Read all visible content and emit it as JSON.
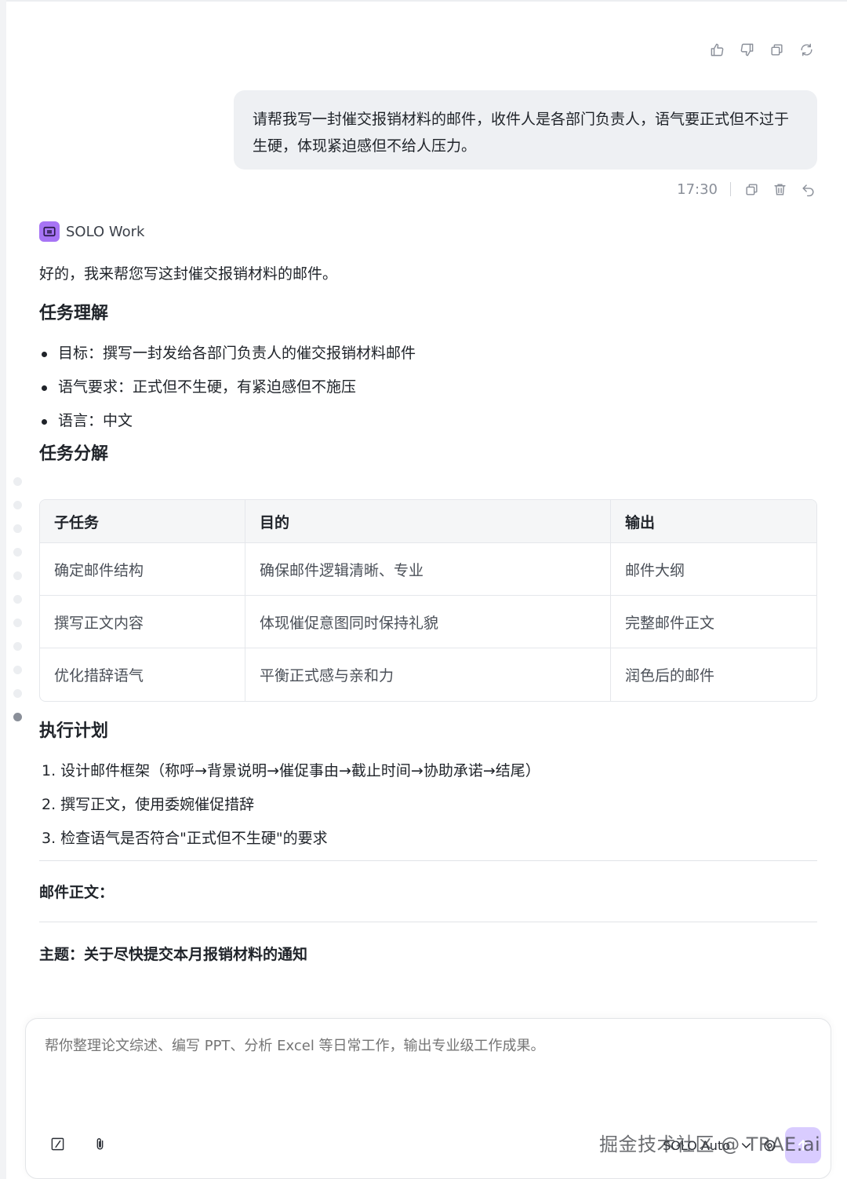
{
  "message_actions": {
    "icons": [
      "thumbs-up-icon",
      "thumbs-down-icon",
      "copy-icon",
      "refresh-icon"
    ]
  },
  "user_message": {
    "text": "请帮我写一封催交报销材料的邮件，收件人是各部门负责人，语气要正式但不过于生硬，体现紧迫感但不给人压力。",
    "time": "17:30",
    "icons": [
      "copy-icon",
      "delete-icon",
      "undo-icon"
    ]
  },
  "agent": {
    "name": "SOLO Work",
    "intro": "好的，我来帮您写这封催交报销材料的邮件。",
    "section1_title": "任务理解",
    "bullets": [
      "目标：撰写一封发给各部门负责人的催交报销材料邮件",
      "语气要求：正式但不生硬，有紧迫感但不施压",
      "语言：中文"
    ],
    "section2_title": "任务分解",
    "table": {
      "headers": [
        "子任务",
        "目的",
        "输出"
      ],
      "rows": [
        [
          "确定邮件结构",
          "确保邮件逻辑清晰、专业",
          "邮件大纲"
        ],
        [
          "撰写正文内容",
          "体现催促意图同时保持礼貌",
          "完整邮件正文"
        ],
        [
          "优化措辞语气",
          "平衡正式感与亲和力",
          "润色后的邮件"
        ]
      ]
    },
    "section3_title": "执行计划",
    "steps": [
      "1. 设计邮件框架（称呼→背景说明→催促事由→截止时间→协助承诺→结尾）",
      "2. 撰写正文，使用委婉催促措辞",
      "3. 检查语气是否符合\"正式但不生硬\"的要求"
    ],
    "email_body_label": "邮件正文：",
    "email_subject": "主题：关于尽快提交本月报销材料的通知"
  },
  "composer": {
    "placeholder": "帮你整理论文综述、编写 PPT、分析 Excel 等日常工作，输出专业级工作成果。",
    "mode_label": "SOLO Auto",
    "watermark": "掘金技术社区 @ TRAE.ai"
  },
  "colors": {
    "accent": "#a774f5",
    "send_button": "#d9ccff",
    "bubble": "#eef0f3"
  }
}
